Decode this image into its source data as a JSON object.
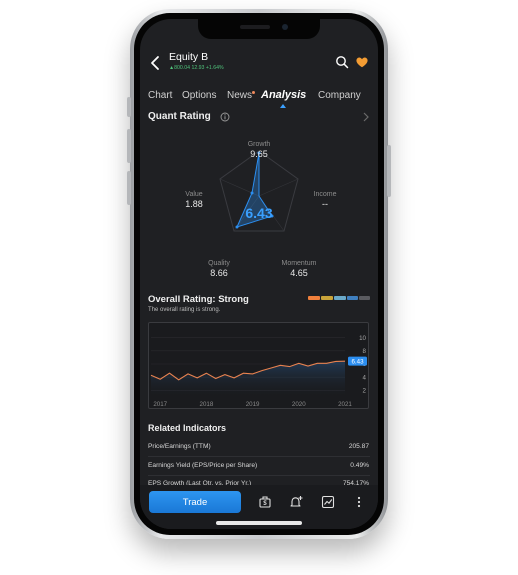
{
  "header": {
    "title": "Equity B",
    "quote": "▲800.04 12.93 +1.64%"
  },
  "tabs": [
    {
      "label": "Chart",
      "active": false,
      "badge": false
    },
    {
      "label": "Options",
      "active": false,
      "badge": false
    },
    {
      "label": "News",
      "active": false,
      "badge": true
    },
    {
      "label": "Analysis",
      "active": true,
      "badge": false
    },
    {
      "label": "Company",
      "active": false,
      "badge": false
    }
  ],
  "quant": {
    "title": "Quant Rating",
    "score": "6.43",
    "axes": [
      {
        "name": "Growth",
        "value": "9.65"
      },
      {
        "name": "Income",
        "value": "--"
      },
      {
        "name": "Momentum",
        "value": "4.65"
      },
      {
        "name": "Quality",
        "value": "8.66"
      },
      {
        "name": "Value",
        "value": "1.88"
      }
    ]
  },
  "overall": {
    "title": "Overall Rating: Strong",
    "subtitle": "The overall rating is strong.",
    "scale_colors": [
      "#f0803c",
      "#c9a43a",
      "#6aa9c9",
      "#3f7fbf",
      "#5a5b60"
    ]
  },
  "chart_data": {
    "type": "line",
    "x_ticks": [
      "2017",
      "2018",
      "2019",
      "2020",
      "2021"
    ],
    "y_ticks": [
      "2",
      "4",
      "6",
      "8",
      "10"
    ],
    "ylim": [
      1,
      11
    ],
    "current_label": "6.43",
    "series": [
      {
        "x": [
          2016.8,
          2017.0,
          2017.2,
          2017.4,
          2017.6,
          2017.8,
          2018.0,
          2018.2,
          2018.4,
          2018.6,
          2018.8,
          2019.0,
          2019.2,
          2019.4,
          2019.6,
          2019.8,
          2020.0,
          2020.2,
          2020.4,
          2020.6,
          2020.8,
          2021.0
        ],
        "y": [
          4.3,
          3.7,
          4.6,
          3.6,
          4.5,
          3.9,
          4.6,
          3.8,
          4.4,
          3.9,
          4.6,
          4.5,
          5.0,
          5.4,
          5.8,
          5.6,
          6.1,
          5.7,
          6.1,
          6.1,
          6.4,
          6.43
        ]
      }
    ]
  },
  "related": {
    "title": "Related Indicators",
    "rows": [
      {
        "label": "Price/Earnings (TTM)",
        "value": "205.87"
      },
      {
        "label": "Earnings Yield (EPS/Price per Share)",
        "value": "0.49%"
      },
      {
        "label": "EPS Growth (Last Qtr. vs. Prior Yr.)",
        "value": "754.17%"
      }
    ]
  },
  "bottom": {
    "trade_label": "Trade"
  },
  "colors": {
    "accent": "#2b8ef0",
    "line": "#e8824f",
    "positive": "#4fc17a",
    "favorite": "#f39c33"
  }
}
